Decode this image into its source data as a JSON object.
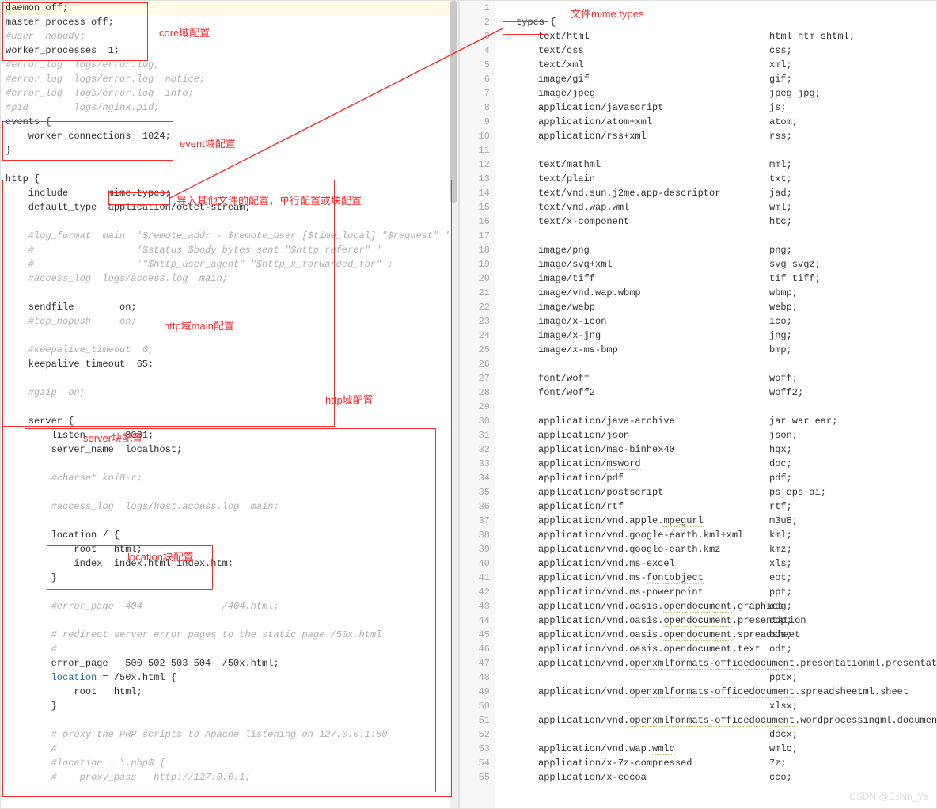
{
  "annotations": {
    "core": "core域配置",
    "event": "event域配置",
    "include": "导入其他文件的配置，单行配置或块配置",
    "httpmain": "http域main配置",
    "http": "http域配置",
    "server": "server块配置",
    "location": "location块配置",
    "mime_title": "文件mime.types"
  },
  "left_lines": [
    {
      "t": "daemon off;",
      "cls": "val",
      "hl": true
    },
    {
      "t": "master_process off;",
      "cls": "val"
    },
    {
      "t": "#user  nobody;",
      "cls": "cmt"
    },
    {
      "t": "worker_processes  1;",
      "cls": "val"
    },
    {
      "t": "#error_log  logs/error.log;",
      "cls": "cmt"
    },
    {
      "t": "#error_log  logs/error.log  notice;",
      "cls": "cmt"
    },
    {
      "t": "#error_log  logs/error.log  info;",
      "cls": "cmt"
    },
    {
      "t": "#pid        logs/nginx.pid;",
      "cls": "cmt"
    },
    {
      "t": "events {",
      "cls": "val"
    },
    {
      "t": "    worker_connections  1024;",
      "cls": "val"
    },
    {
      "t": "}",
      "cls": "val"
    },
    {
      "t": "",
      "cls": "val"
    },
    {
      "t": "http {",
      "cls": "val"
    },
    {
      "t": "    include       mime.types;",
      "cls": "val"
    },
    {
      "t": "    default_type  application/octet-stream;",
      "cls": "val"
    },
    {
      "t": "",
      "cls": "val"
    },
    {
      "t": "    #log_format  main  '$remote_addr - $remote_user [$time_local] \"$request\" '",
      "cls": "cmt"
    },
    {
      "t": "    #                  '$status $body_bytes_sent \"$http_referer\" '",
      "cls": "cmt"
    },
    {
      "t": "    #                  '\"$http_user_agent\" \"$http_x_forwarded_for\"';",
      "cls": "cmt"
    },
    {
      "t": "    #access_log  logs/access.log  main;",
      "cls": "cmt"
    },
    {
      "t": "",
      "cls": "val"
    },
    {
      "t": "    sendfile        on;",
      "cls": "val"
    },
    {
      "t": "    #tcp_nopush     on;",
      "cls": "cmt"
    },
    {
      "t": "",
      "cls": "val"
    },
    {
      "t": "    #keepalive_timeout  0;",
      "cls": "cmt"
    },
    {
      "t": "    keepalive_timeout  65;",
      "cls": "val"
    },
    {
      "t": "",
      "cls": "val"
    },
    {
      "t": "    #gzip  on;",
      "cls": "cmt"
    },
    {
      "t": "",
      "cls": "val"
    },
    {
      "t": "    server {",
      "cls": "val"
    },
    {
      "t": "        listen       8081;",
      "cls": "val"
    },
    {
      "t": "        server_name  localhost;",
      "cls": "val"
    },
    {
      "t": "",
      "cls": "val"
    },
    {
      "t": "        #charset koi8-r;",
      "cls": "cmt"
    },
    {
      "t": "",
      "cls": "val"
    },
    {
      "t": "        #access_log  logs/host.access.log  main;",
      "cls": "cmt"
    },
    {
      "t": "",
      "cls": "val"
    },
    {
      "t": "        location / {",
      "cls": "val"
    },
    {
      "t": "            root   html;",
      "cls": "val"
    },
    {
      "t": "            index  index.html index.htm;",
      "cls": "val"
    },
    {
      "t": "        }",
      "cls": "val"
    },
    {
      "t": "",
      "cls": "val"
    },
    {
      "t": "        #error_page  404              /404.html;",
      "cls": "cmt"
    },
    {
      "t": "",
      "cls": "val"
    },
    {
      "t": "        # redirect server error pages to the static page /50x.html",
      "cls": "cmt"
    },
    {
      "t": "        #",
      "cls": "cmt"
    },
    {
      "t": "        error_page   500 502 503 504  /50x.html;",
      "cls": "val"
    },
    {
      "t": "        location = /50x.html {",
      "cls": "val",
      "blue": "location"
    },
    {
      "t": "            root   html;",
      "cls": "val"
    },
    {
      "t": "        }",
      "cls": "val"
    },
    {
      "t": "",
      "cls": "val"
    },
    {
      "t": "        # proxy the PHP scripts to Apache listening on 127.0.0.1:80",
      "cls": "cmt"
    },
    {
      "t": "        #",
      "cls": "cmt"
    },
    {
      "t": "        #location ~ \\.php$ {",
      "cls": "cmt"
    },
    {
      "t": "        #    proxy_pass   http://127.0.0.1;",
      "cls": "cmt"
    }
  ],
  "right_start": 1,
  "right_header": "types {",
  "mime": [
    {
      "m": "text/html",
      "e": "html htm shtml;"
    },
    {
      "m": "text/css",
      "e": "css;"
    },
    {
      "m": "text/xml",
      "e": "xml;"
    },
    {
      "m": "image/gif",
      "e": "gif;"
    },
    {
      "m": "image/jpeg",
      "e": "jpeg jpg;"
    },
    {
      "m": "application/javascript",
      "e": "js;"
    },
    {
      "m": "application/atom+xml",
      "e": "atom;"
    },
    {
      "m": "application/rss+xml",
      "e": "rss;"
    },
    {
      "m": "",
      "e": ""
    },
    {
      "m": "text/mathml",
      "e": "mml;"
    },
    {
      "m": "text/plain",
      "e": "txt;"
    },
    {
      "m": "text/vnd.sun.j2me.app-descriptor",
      "e": "jad;"
    },
    {
      "m": "text/vnd.wap.wml",
      "e": "wml;"
    },
    {
      "m": "text/x-component",
      "e": "htc;"
    },
    {
      "m": "",
      "e": ""
    },
    {
      "m": "image/png",
      "e": "png;"
    },
    {
      "m": "image/svg+xml",
      "e": "svg svgz;"
    },
    {
      "m": "image/tiff",
      "e": "tif tiff;"
    },
    {
      "m": "image/vnd.wap.wbmp",
      "e": "wbmp;"
    },
    {
      "m": "image/webp",
      "e": "webp;"
    },
    {
      "m": "image/x-icon",
      "e": "ico;"
    },
    {
      "m": "image/x-jng",
      "e": "jng;"
    },
    {
      "m": "image/x-ms-bmp",
      "e": "bmp;"
    },
    {
      "m": "",
      "e": ""
    },
    {
      "m": "font/woff",
      "e": "woff;"
    },
    {
      "m": "font/woff2",
      "e": "woff2;"
    },
    {
      "m": "",
      "e": ""
    },
    {
      "m": "application/java-archive",
      "e": "jar war ear;"
    },
    {
      "m": "application/json",
      "e": "json;"
    },
    {
      "m": "application/mac-binhex40",
      "e": "hqx;"
    },
    {
      "m": "application/msword",
      "e": "doc;",
      "u": "msword"
    },
    {
      "m": "application/pdf",
      "e": "pdf;"
    },
    {
      "m": "application/postscript",
      "e": "ps eps ai;"
    },
    {
      "m": "application/rtf",
      "e": "rtf;"
    },
    {
      "m": "application/vnd.apple.mpegurl",
      "e": "m3u8;",
      "u": "mpegurl"
    },
    {
      "m": "application/vnd.google-earth.kml+xml",
      "e": "kml;"
    },
    {
      "m": "application/vnd.google-earth.kmz",
      "e": "kmz;"
    },
    {
      "m": "application/vnd.ms-excel",
      "e": "xls;"
    },
    {
      "m": "application/vnd.ms-fontobject",
      "e": "eot;",
      "u": "fontobject"
    },
    {
      "m": "application/vnd.ms-powerpoint",
      "e": "ppt;"
    },
    {
      "m": "application/vnd.oasis.opendocument.graphics",
      "e": "odg;",
      "u": "opendocument"
    },
    {
      "m": "application/vnd.oasis.opendocument.presentation",
      "e": "odp;",
      "u": "opendocument"
    },
    {
      "m": "application/vnd.oasis.opendocument.spreadsheet",
      "e": "ods;",
      "u": "opendocument"
    },
    {
      "m": "application/vnd.oasis.opendocument.text",
      "e": "odt;",
      "u": "opendocument"
    },
    {
      "m": "application/vnd.openxmlformats-officedocument.presentationml.presentation",
      "e": "",
      "u": "openxmlformats-officedocument"
    },
    {
      "m": "",
      "e": "pptx;"
    },
    {
      "m": "application/vnd.openxmlformats-officedocument.spreadsheetml.sheet",
      "e": "",
      "u": "openxmlformats-officedocument"
    },
    {
      "m": "",
      "e": "xlsx;"
    },
    {
      "m": "application/vnd.openxmlformats-officedocument.wordprocessingml.document",
      "e": "",
      "u": "openxmlformats-officedocument"
    },
    {
      "m": "",
      "e": "docx;"
    },
    {
      "m": "application/vnd.wap.wmlc",
      "e": "wmlc;",
      "u": "wmlc"
    },
    {
      "m": "application/x-7z-compressed",
      "e": "7z;"
    },
    {
      "m": "application/x-cocoa",
      "e": "cco;"
    }
  ],
  "watermark": "CSDN @Eshin_Ye"
}
